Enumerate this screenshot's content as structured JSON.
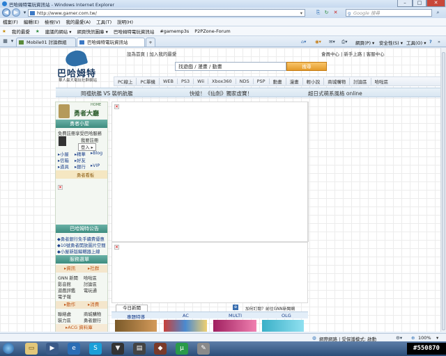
{
  "window": {
    "title": "巴哈姆特電玩資訊站 - Windows Internet Explorer",
    "min": "–",
    "max": "□",
    "close": "✕"
  },
  "address": {
    "url": "http://www.gamer.com.tw/",
    "search_placeholder": "Google 搜尋"
  },
  "menu": [
    "檔案(F)",
    "編輯(E)",
    "檢視(V)",
    "我的最愛(A)",
    "工具(T)",
    "說明(H)"
  ],
  "favorites": {
    "label": "我的最愛",
    "items": [
      "建議的網站 ▾",
      "網頁快訊圖庫 ▾",
      "巴哈姆特電玩資訊站",
      "#gamemp3s",
      "P2PZone-Forum"
    ]
  },
  "tabs": [
    {
      "label": "Mobile01 討論群組"
    },
    {
      "label": "巴哈姆特電玩資訊站"
    }
  ],
  "commandbar": {
    "home": "",
    "page": "網頁(P) ▾",
    "safety": "安全性(S) ▾",
    "tools": "工具(O) ▾",
    "help": "?"
  },
  "site": {
    "toplinks": "設為首頁 | 加入我的最愛",
    "toplinks_right": "會員中心 | 新手上路 | 客服中心",
    "logo_name": "巴哈姆特",
    "logo_sub": "華人最大電玩社群網站",
    "search_value": "找遊戲 / 漫畫 / 動畫",
    "search_button": "搜尋",
    "categories": [
      "PC線上",
      "PC單機",
      "WEB",
      "PS3",
      "Wii",
      "Xbox360",
      "NDS",
      "PSP",
      "動畫",
      "漫畫",
      "輕小說",
      "商城購物",
      "討論區",
      "哈啦區"
    ],
    "news": [
      "岡禮航艦 VS 裝帆航艦",
      "快搶！《仙劍》獨家虛寶！",
      "超日式萌系風格 online"
    ]
  },
  "sidebar": {
    "home_label": "HOME",
    "brave_title": "勇者大廳",
    "house_head": "勇者小屋",
    "login_prompt": "免費註冊享受巴哈服務",
    "register": "我要註冊",
    "login_btn": "登入 ▸",
    "links": [
      [
        "小屋",
        "精華",
        "Blog"
      ],
      [
        "信箱",
        "好友"
      ],
      [
        "道具",
        "銀行",
        "VIP"
      ]
    ],
    "board_head": "勇者看板",
    "notice_head": "巴哈姆特公告",
    "notices": [
      "勇者銀行免手續費優惠",
      "10號勇者開放圖片空間",
      "小屋新版編輯器上線"
    ],
    "service_head": "服務選單",
    "service_tabs": [
      "資訊",
      "社群"
    ],
    "service_items": [
      [
        "GNN 新聞",
        "哈啦區"
      ],
      [
        "影音館",
        "討論區"
      ],
      [
        "遊戲評鑑",
        "電玩通"
      ],
      [
        "電子報",
        ""
      ]
    ],
    "service_tabs2": [
      "動作",
      "消費"
    ],
    "service_items2": [
      [
        "聯絡處",
        "商城購物"
      ],
      [
        "裝力區",
        "勇者銀行"
      ]
    ],
    "acg": "ACG 資料庫"
  },
  "main": {
    "today_tab": "今日新聞",
    "today_link": "加何訂閱？前往GNN新聞網",
    "sections": [
      "專題特導",
      "AC",
      "MULTI",
      "OLG"
    ]
  },
  "status": {
    "text": "網際網路 | 受保護模式: 啟動",
    "zoom": "100%"
  },
  "stamp": "#550870"
}
